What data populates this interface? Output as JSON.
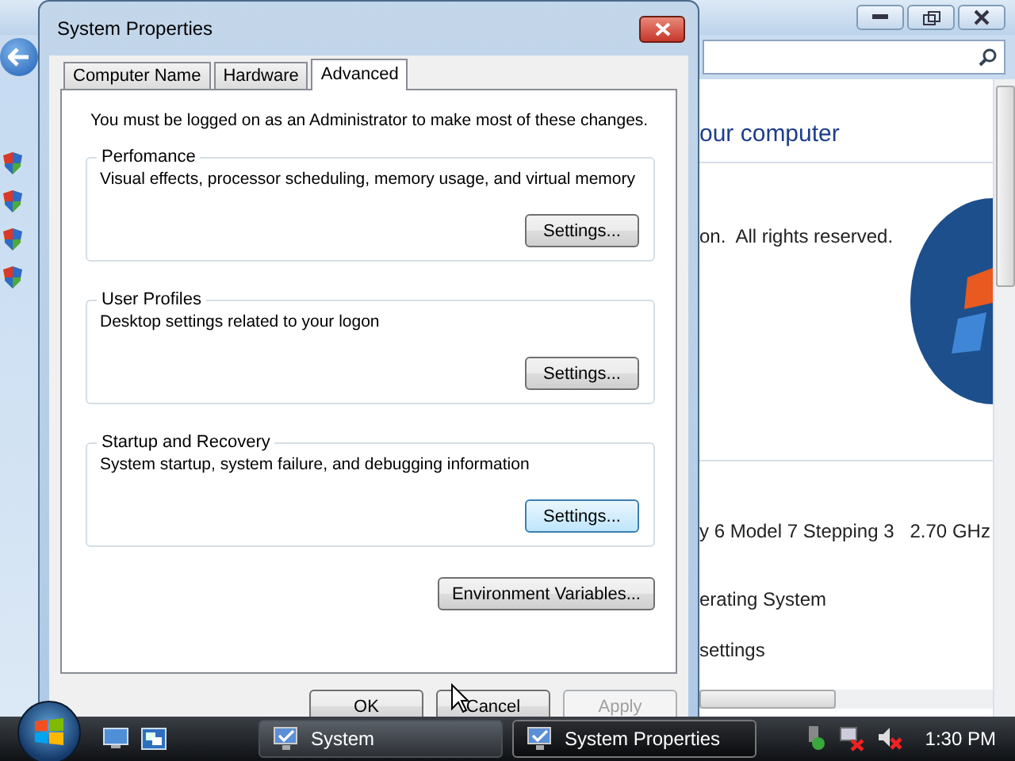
{
  "background_window": {
    "heading": "our computer",
    "copyright": "on.  All rights reserved.",
    "processor": "y 6 Model 7 Stepping 3   2.70 GHz",
    "os": "erating System",
    "settings_link": "settings"
  },
  "dialog": {
    "title": "System Properties",
    "tabs": [
      {
        "label": "Computer Name",
        "selected": false
      },
      {
        "label": "Hardware",
        "selected": false
      },
      {
        "label": "Advanced",
        "selected": true
      }
    ],
    "intro": "You must be logged on as an Administrator to make most of these changes.",
    "groups": [
      {
        "title": "Perfomance",
        "description": "Visual effects, processor scheduling, memory usage, and virtual memory",
        "button": "Settings...",
        "focused": false
      },
      {
        "title": "User Profiles",
        "description": "Desktop settings related to your logon",
        "button": "Settings...",
        "focused": false
      },
      {
        "title": "Startup and Recovery",
        "description": "System startup, system failure, and debugging information",
        "button": "Settings...",
        "focused": true
      }
    ],
    "environment_button": "Environment Variables...",
    "footer_buttons": [
      {
        "label": "OK",
        "disabled": false
      },
      {
        "label": "Cancel",
        "disabled": false
      },
      {
        "label": "Apply",
        "disabled": true
      }
    ]
  },
  "taskbar": {
    "tasks": [
      {
        "label": "System",
        "selected": false
      },
      {
        "label": "System Properties",
        "selected": true
      }
    ],
    "clock": "1:30 PM"
  }
}
